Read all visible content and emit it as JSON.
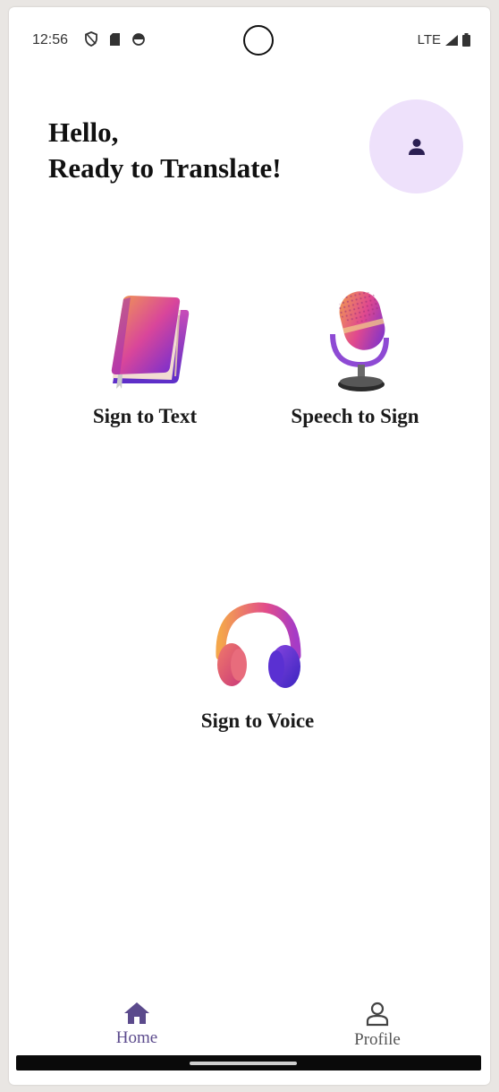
{
  "status_bar": {
    "time": "12:56",
    "network": "LTE"
  },
  "header": {
    "line1": "Hello,",
    "line2": "Ready to Translate!"
  },
  "features": [
    {
      "label": "Sign to Text",
      "icon": "book-icon"
    },
    {
      "label": "Speech to Sign",
      "icon": "microphone-icon"
    },
    {
      "label": "Sign to Voice",
      "icon": "headphones-icon"
    }
  ],
  "nav": {
    "home_label": "Home",
    "profile_label": "Profile"
  },
  "colors": {
    "accent": "#5b4a8c",
    "avatar_bg": "#eee1fb",
    "avatar_icon": "#2b1f52"
  }
}
